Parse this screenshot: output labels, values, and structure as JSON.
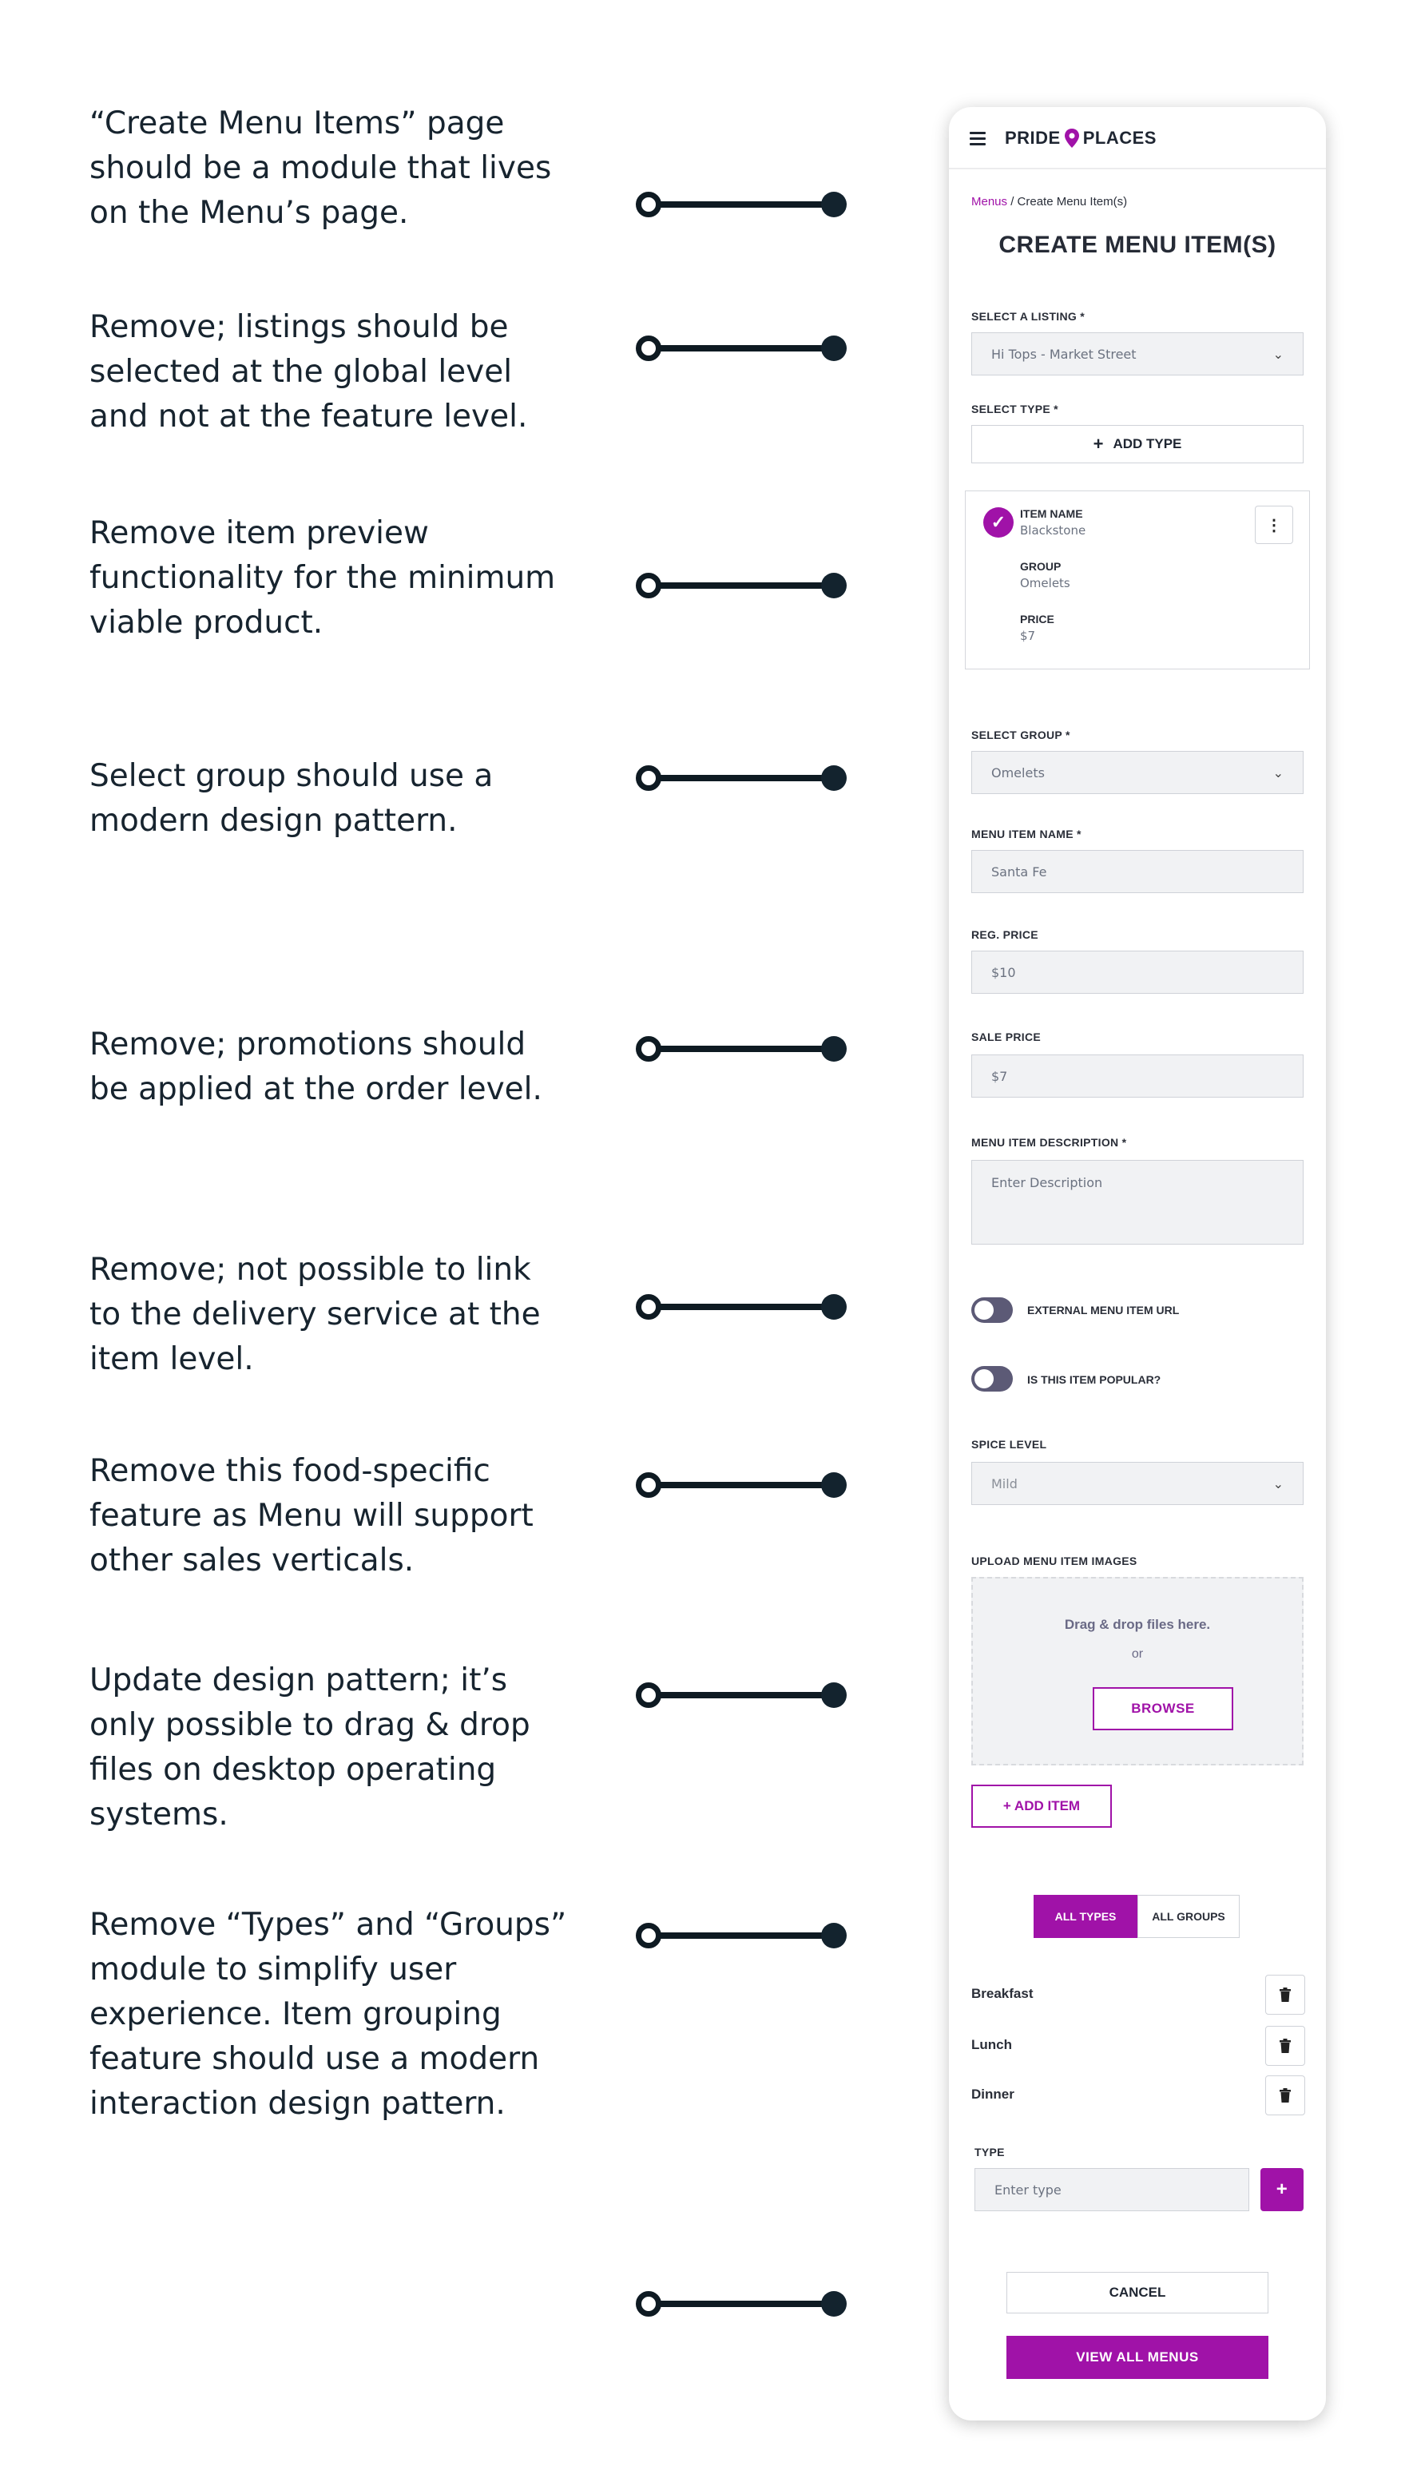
{
  "notes": [
    "“Create Menu Items” page should be a module that lives on the Menu’s page.",
    "Remove; listings should be selected at the global level and not at the feature level.",
    "Remove item preview functionality for the minimum viable product.",
    "Select group should use a modern design pattern.",
    "Remove; promotions should be applied at the order level.",
    "Remove; not possible to link to the delivery service at the item level.",
    "Remove this food-specific feature as Menu will support other sales verticals.",
    "Update design pattern; it’s only possible to drag & drop files on desktop operating systems.",
    "Remove “Types” and “Groups” module to simplify user experience. Item grouping feature should use a modern interaction design pattern."
  ],
  "app": {
    "brand_left": "PRIDE",
    "brand_right": "PLACES",
    "accent_color": "#a012a8"
  },
  "breadcrumb": {
    "link": "Menus",
    "separator": " / ",
    "current": "Create Menu Item(s)"
  },
  "page_title": "CREATE MENU ITEM(S)",
  "listing": {
    "label": "SELECT A LISTING *",
    "value": "Hi Tops - Market Street"
  },
  "type": {
    "label": "SELECT TYPE *",
    "add_button": "ADD TYPE"
  },
  "preview_card": {
    "name_label": "ITEM NAME",
    "name_value": "Blackstone",
    "group_label": "GROUP",
    "group_value": "Omelets",
    "price_label": "PRICE",
    "price_value": "$7"
  },
  "group": {
    "label": "SELECT GROUP *",
    "value": "Omelets"
  },
  "item_name": {
    "label": "MENU ITEM NAME *",
    "value": "Santa Fe"
  },
  "reg_price": {
    "label": "REG. PRICE",
    "value": "$10"
  },
  "sale_price": {
    "label": "SALE PRICE",
    "value": "$7"
  },
  "description": {
    "label": "MENU ITEM DESCRIPTION *",
    "placeholder": "Enter Description"
  },
  "toggles": {
    "external_url": "EXTERNAL MENU ITEM URL",
    "popular": "IS THIS ITEM POPULAR?"
  },
  "spice": {
    "label": "SPICE LEVEL",
    "value": "Mild"
  },
  "upload": {
    "label": "UPLOAD MENU ITEM IMAGES",
    "drag_text": "Drag & drop files here.",
    "or_text": "or",
    "browse": "BROWSE"
  },
  "add_item": "+ ADD ITEM",
  "segments": {
    "types": "ALL TYPES",
    "groups": "ALL GROUPS"
  },
  "type_rows": [
    "Breakfast",
    "Lunch",
    "Dinner"
  ],
  "type_input": {
    "label": "TYPE",
    "placeholder": "Enter type",
    "add_symbol": "+"
  },
  "actions": {
    "cancel": "CANCEL",
    "view_all": "VIEW ALL MENUS"
  }
}
